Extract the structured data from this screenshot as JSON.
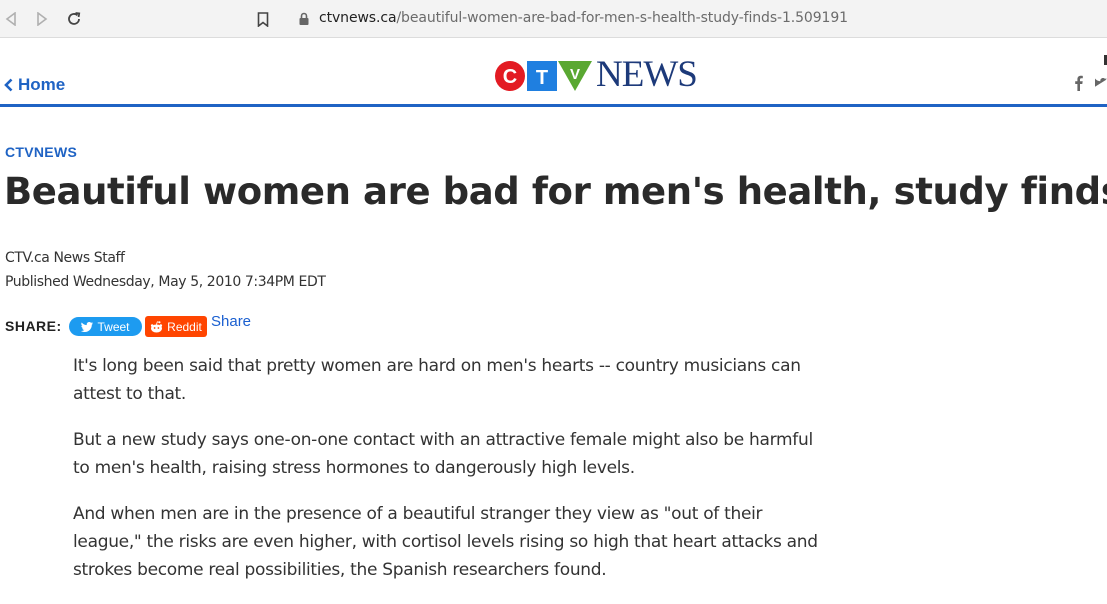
{
  "browser": {
    "url_host": "ctvnews.ca",
    "url_path": "/beautiful-women-are-bad-for-men-s-health-study-finds-1.509191"
  },
  "header": {
    "home_label": "Home",
    "logo_news": "NEWS",
    "logo_letters": [
      "C",
      "T",
      "V"
    ],
    "colors": {
      "accent": "#1f63c4",
      "logo_red": "#e31b23",
      "logo_blue": "#1f7fe0",
      "logo_green": "#5aa832",
      "logo_navy": "#1d3a7a"
    }
  },
  "article": {
    "category": "CTVNEWS",
    "headline": "Beautiful women are bad for men's health, study finds",
    "byline": "CTV.ca News Staff",
    "published": "Published Wednesday, May 5, 2010 7:34PM EDT",
    "share": {
      "label": "SHARE:",
      "tweet_label": "Tweet",
      "reddit_label": "Reddit",
      "share_label": "Share"
    },
    "paragraphs": [
      "It's long been said that pretty women are hard on men's hearts -- country musicians can attest to that.",
      "But a new study says one-on-one contact with an attractive female might also be harmful to men's health, raising stress hormones to dangerously high levels.",
      "And when men are in the presence of a beautiful stranger they view as \"out of their league,\" the risks are even higher, with cortisol levels rising so high that heart attacks and strokes become real possibilities, the Spanish researchers found."
    ]
  }
}
